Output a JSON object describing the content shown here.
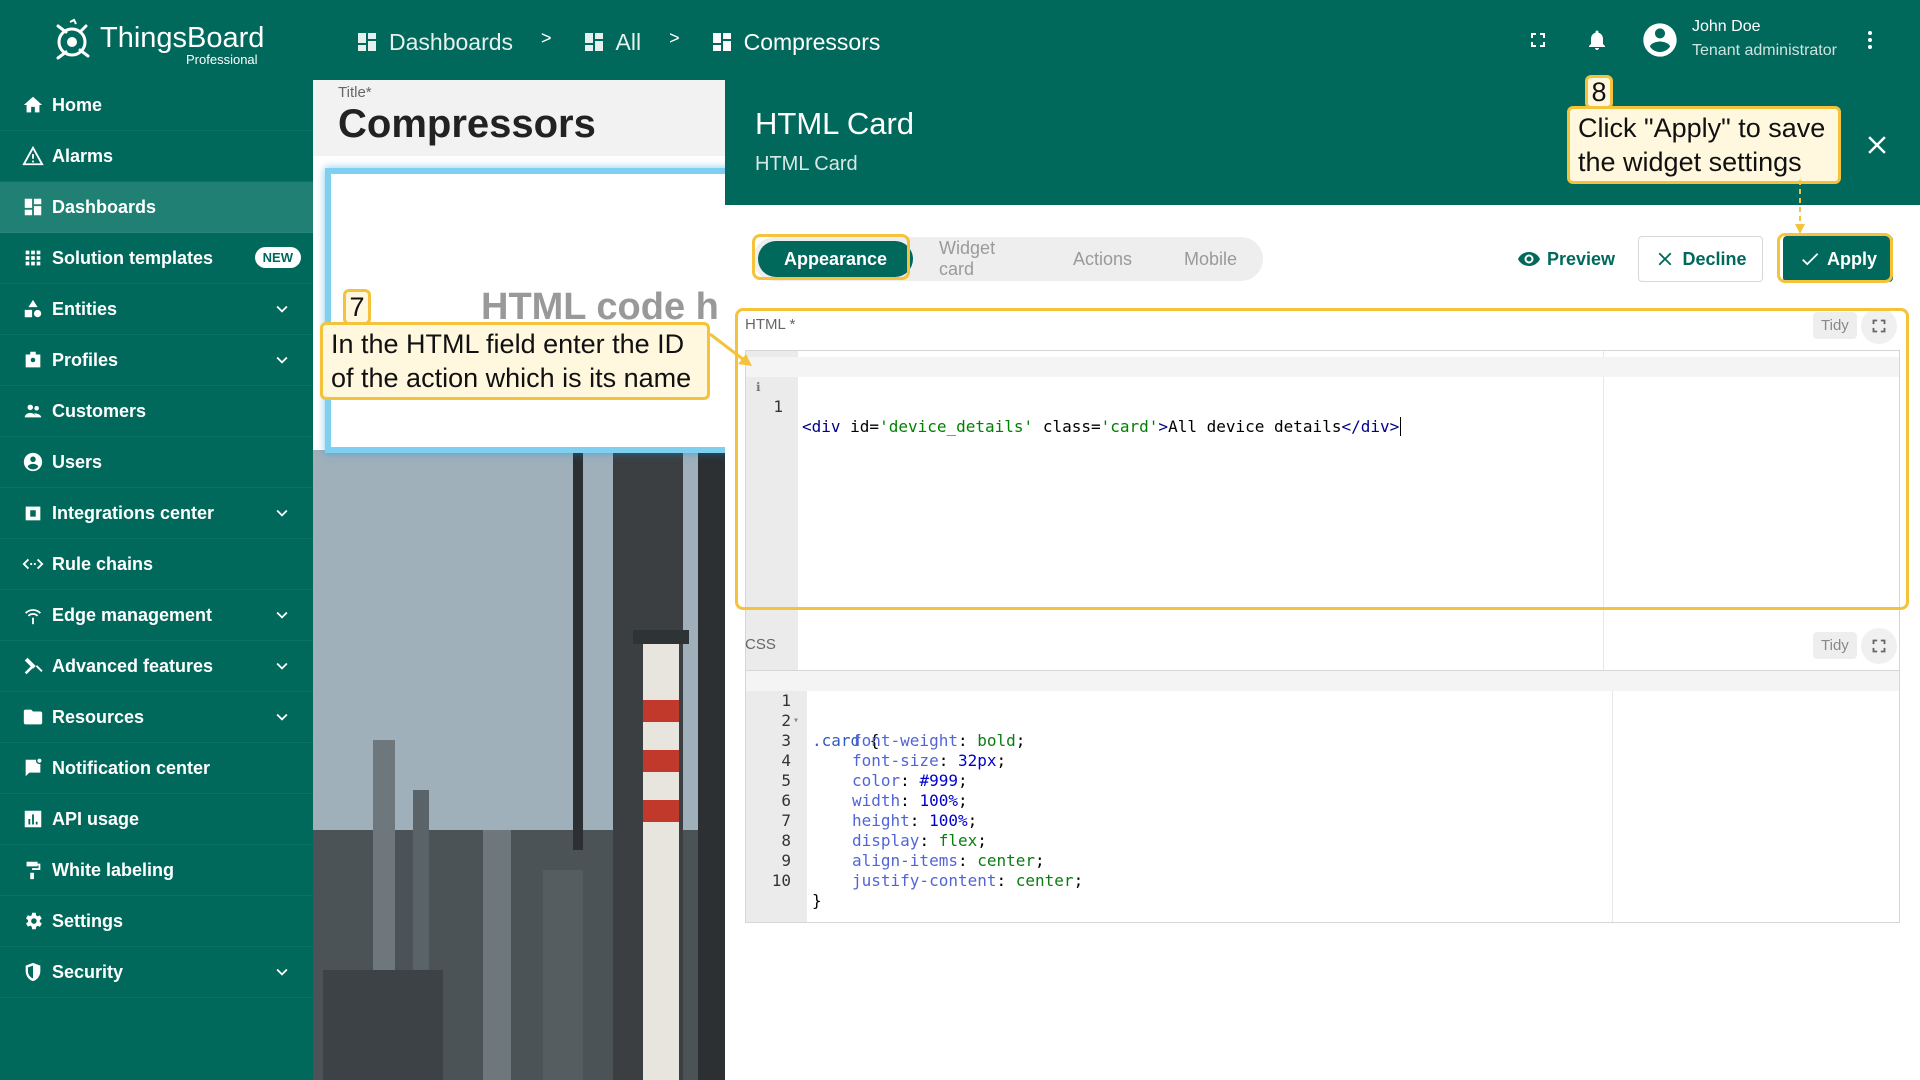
{
  "app": {
    "logo_text": "ThingsBoard",
    "logo_sub": "Professional"
  },
  "breadcrumbs": [
    {
      "label": "Dashboards"
    },
    {
      "label": "All"
    },
    {
      "label": "Compressors"
    }
  ],
  "breadcrumb_separator": ">",
  "user": {
    "name": "John Doe",
    "role": "Tenant administrator"
  },
  "sidebar": {
    "items": [
      {
        "label": "Home",
        "icon": "home-icon"
      },
      {
        "label": "Alarms",
        "icon": "warning-icon"
      },
      {
        "label": "Dashboards",
        "icon": "dashboard-icon",
        "active": true
      },
      {
        "label": "Solution templates",
        "icon": "apps-icon",
        "badge": "NEW"
      },
      {
        "label": "Entities",
        "icon": "entities-icon",
        "expandable": true
      },
      {
        "label": "Profiles",
        "icon": "profiles-icon",
        "expandable": true
      },
      {
        "label": "Customers",
        "icon": "customers-icon"
      },
      {
        "label": "Users",
        "icon": "user-icon"
      },
      {
        "label": "Integrations center",
        "icon": "integrations-icon",
        "expandable": true
      },
      {
        "label": "Rule chains",
        "icon": "rule-chains-icon"
      },
      {
        "label": "Edge management",
        "icon": "edge-icon",
        "expandable": true
      },
      {
        "label": "Advanced features",
        "icon": "tools-icon",
        "expandable": true
      },
      {
        "label": "Resources",
        "icon": "folder-icon",
        "expandable": true
      },
      {
        "label": "Notification center",
        "icon": "notification-icon"
      },
      {
        "label": "API usage",
        "icon": "chart-icon"
      },
      {
        "label": "White labeling",
        "icon": "paint-roller-icon"
      },
      {
        "label": "Settings",
        "icon": "gear-icon"
      },
      {
        "label": "Security",
        "icon": "shield-icon",
        "expandable": true
      }
    ]
  },
  "dashboard": {
    "title_label": "Title*",
    "title": "Compressors",
    "widget_text": "HTML code h"
  },
  "dialog": {
    "title": "HTML Card",
    "subtitle": "HTML Card",
    "tabs": [
      {
        "label": "Appearance",
        "active": true
      },
      {
        "label": "Widget card"
      },
      {
        "label": "Actions"
      },
      {
        "label": "Mobile"
      }
    ],
    "preview_label": "Preview",
    "decline_label": "Decline",
    "apply_label": "Apply",
    "html_label": "HTML *",
    "css_label": "CSS",
    "tidy_label": "Tidy",
    "html_code": {
      "line_number": "1",
      "open_tag": "<div",
      "attr_id": " id=",
      "val_id": "'device_details'",
      "attr_class": " class=",
      "val_class": "'card'",
      "gt": ">",
      "text": "All device details",
      "close_tag": "</div>"
    },
    "css_lines": [
      {
        "n": "1",
        "selector": ".card",
        "rest": " {"
      },
      {
        "n": "2",
        "prop": "font-weight",
        "value": "bold",
        "kind": "val"
      },
      {
        "n": "3",
        "prop": "font-size",
        "value": "32px",
        "kind": "num"
      },
      {
        "n": "4",
        "prop": "color",
        "value": "#999",
        "kind": "num"
      },
      {
        "n": "5",
        "prop": "width",
        "value": "100%",
        "kind": "num"
      },
      {
        "n": "6",
        "prop": "height",
        "value": "100%",
        "kind": "num"
      },
      {
        "n": "7",
        "prop": "display",
        "value": "flex",
        "kind": "val"
      },
      {
        "n": "8",
        "prop": "align-items",
        "value": "center",
        "kind": "val"
      },
      {
        "n": "9",
        "prop": "justify-content",
        "value": "center",
        "kind": "val"
      },
      {
        "n": "10",
        "close": "}"
      }
    ]
  },
  "annotations": {
    "step7_number": "7",
    "step7_text_line1": "In the HTML field enter the ID",
    "step7_text_line2": "of the action which is its name",
    "step8_number": "8",
    "step8_text_line1": "Click \"Apply\" to save",
    "step8_text_line2": "the widget settings"
  },
  "colors": {
    "primary": "#00695c",
    "active_nav": "#1f8073",
    "highlight": "#f5c33b",
    "callout_bg": "#fff8de"
  }
}
